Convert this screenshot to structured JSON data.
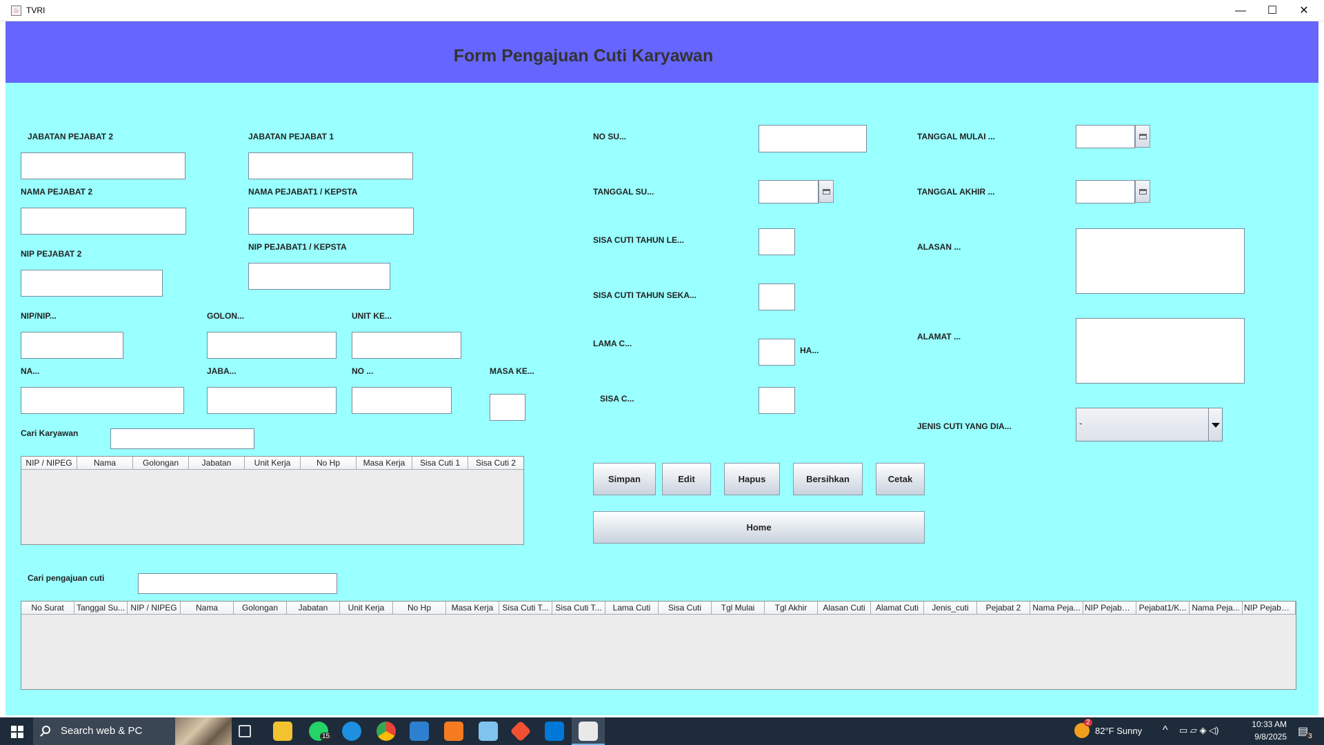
{
  "window": {
    "title": "TVRI",
    "minimize_glyph": "—",
    "maximize_glyph": "☐",
    "close_glyph": "✕"
  },
  "header": {
    "title": "Form Pengajuan Cuti Karyawan"
  },
  "pejabat": {
    "jabatan_pejabat2_label": "JABATAN PEJABAT 2",
    "jabatan_pejabat1_label": "JABATAN PEJABAT 1",
    "nama_pejabat2_label": "NAMA PEJABAT 2",
    "nama_pejabat1_label": "NAMA PEJABAT1 / KEPSTA",
    "nip_pejabat2_label": "NIP PEJABAT 2",
    "nip_pejabat1_label": "NIP PEJABAT1 / KEPSTA"
  },
  "karyawan": {
    "nip_label": "NIP/NIP...",
    "golongan_label": "GOLON...",
    "unit_kerja_label": "UNIT KE...",
    "nama_label": "NA...",
    "jabatan_label": "JABA...",
    "no_hp_label": "NO ...",
    "masa_kerja_label": "MASA KE...",
    "cari_label": "Cari Karyawan"
  },
  "karyawan_table": {
    "columns": [
      "NIP / NIPEG",
      "Nama",
      "Golongan",
      "Jabatan",
      "Unit Kerja",
      "No Hp",
      "Masa Kerja",
      "Sisa Cuti 1",
      "Sisa Cuti 2"
    ]
  },
  "surat": {
    "no_surat_label": "NO SU...",
    "tanggal_surat_label": "TANGGAL SU...",
    "sisa_cuti_lalu_label": "SISA CUTI TAHUN LE...",
    "sisa_cuti_sekarang_label": "SISA CUTI TAHUN SEKA...",
    "lama_cuti_label": "LAMA C...",
    "hari_label": "HA...",
    "sisa_cuti_label": "SISA C..."
  },
  "cuti": {
    "tanggal_mulai_label": "TANGGAL MULAI ...",
    "tanggal_akhir_label": "TANGGAL AKHIR ...",
    "alasan_label": "ALASAN ...",
    "alamat_label": "ALAMAT ...",
    "jenis_cuti_label": "JENIS CUTI YANG DIA...",
    "jenis_cuti_value": "-"
  },
  "buttons": {
    "simpan": "Simpan",
    "edit": "Edit",
    "hapus": "Hapus",
    "bersihkan": "Bersihkan",
    "cetak": "Cetak",
    "home": "Home"
  },
  "pengajuan": {
    "cari_label": "Cari pengajuan cuti"
  },
  "pengajuan_table": {
    "columns": [
      "No Surat",
      "Tanggal Su...",
      "NIP / NIPEG",
      "Nama",
      "Golongan",
      "Jabatan",
      "Unit Kerja",
      "No Hp",
      "Masa Kerja",
      "Sisa Cuti T...",
      "Sisa Cuti T...",
      "Lama Cuti",
      "Sisa Cuti",
      "Tgl Mulai",
      "Tgl Akhir",
      "Alasan Cuti",
      "Alamat Cuti",
      "Jenis_cuti",
      "Pejabat 2",
      "Nama Peja...",
      "NIP Pejabat 2",
      "Pejabat1/K...",
      "Nama Peja...",
      "NIP Pejabat..."
    ]
  },
  "taskbar": {
    "search_text": "Search web & PC",
    "whatsapp_badge": "15",
    "weather_badge": "2",
    "weather": "82°F  Sunny",
    "time": "10:33 AM",
    "date": "9/8/2025",
    "notification_count": "3",
    "apps": [
      "task-view",
      "file-explorer",
      "whatsapp",
      "edge",
      "chrome",
      "virtualbox",
      "xampp",
      "notepad",
      "git",
      "vscode",
      "java"
    ]
  }
}
